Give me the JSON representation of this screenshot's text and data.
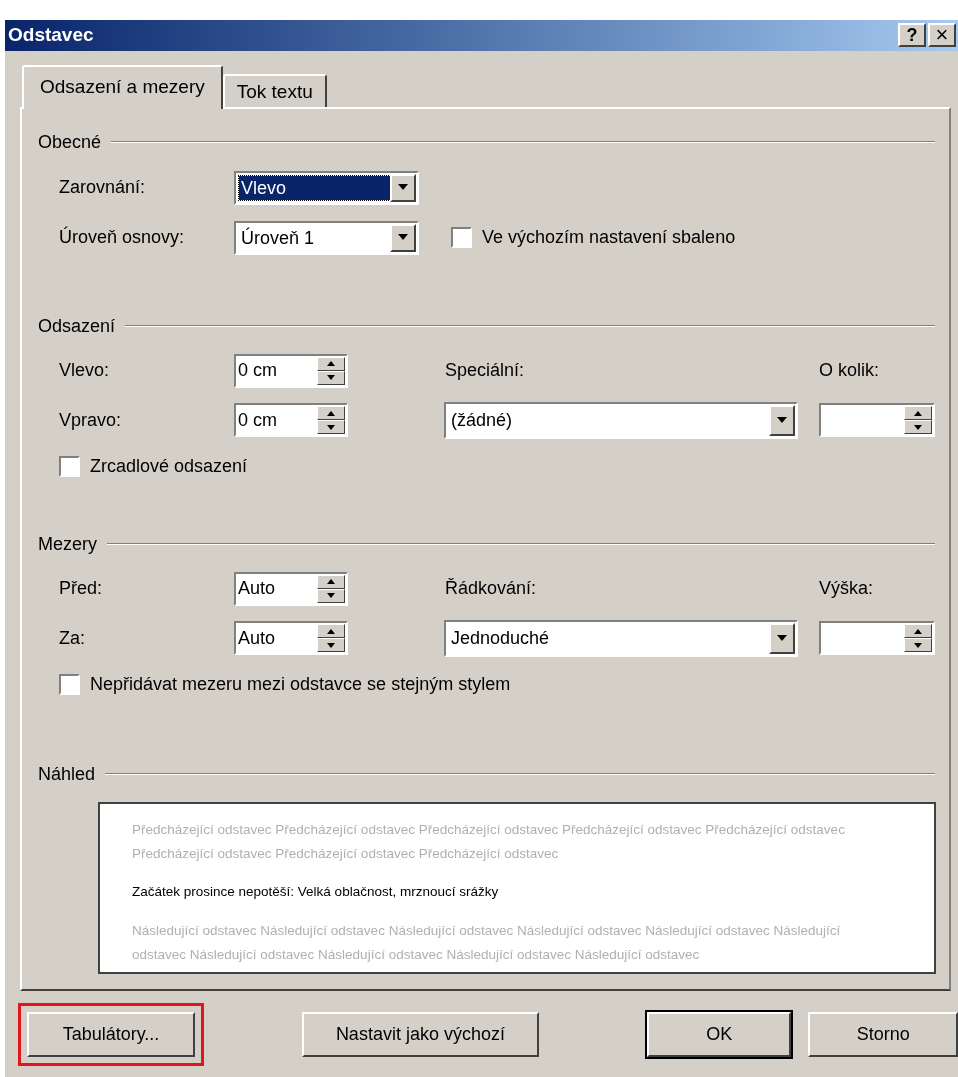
{
  "window": {
    "title": "Odstavec",
    "help": "?",
    "close": "×"
  },
  "tabs": [
    {
      "label": "Odsazení a mezery",
      "selected": true
    },
    {
      "label": "Tok textu",
      "selected": false
    }
  ],
  "general": {
    "heading": "Obecné",
    "alignment": {
      "label": "Zarovnání:",
      "value": "Vlevo",
      "focused": true
    },
    "outline_level": {
      "label": "Úroveň osnovy:",
      "value": "Úroveň 1",
      "focused": false
    },
    "collapsed": {
      "label": "Ve výchozím nastavení sbaleno",
      "checked": false
    }
  },
  "indentation": {
    "heading": "Odsazení",
    "left": {
      "label": "Vlevo:",
      "value": "0 cm"
    },
    "right": {
      "label": "Vpravo:",
      "value": "0 cm"
    },
    "special": {
      "label": "Speciální:",
      "value": "(žádné)"
    },
    "by": {
      "label": "O kolik:"
    },
    "mirror": {
      "label": "Zrcadlové odsazení",
      "checked": false
    }
  },
  "spacing": {
    "heading": "Mezery",
    "before": {
      "label": "Před:",
      "value": "Auto"
    },
    "after": {
      "label": "Za:",
      "value": "Auto"
    },
    "line_spacing": {
      "label": "Řádkování:",
      "value": "Jednoduché"
    },
    "at": {
      "label": "Výška:"
    },
    "no_space": {
      "label": "Nepřidávat mezeru mezi odstavce se stejným stylem",
      "checked": false
    }
  },
  "preview": {
    "heading": "Náhled",
    "previous": "Předcházející odstavec Předcházející odstavec Předcházející odstavec Předcházející odstavec Předcházející odstavec Předcházející odstavec Předcházející odstavec Předcházející odstavec",
    "current": "Začátek prosince nepotěší: Velká oblačnost, mrznoucí srážky",
    "following": "Následující odstavec Následující odstavec Následující odstavec Následující odstavec Následující odstavec Následující odstavec Následující odstavec Následující odstavec Následující odstavec Následující odstavec"
  },
  "buttons": [
    {
      "label": "Tabulátory...",
      "default": false,
      "highlighted": true
    },
    {
      "label": "Nastavit jako výchozí",
      "default": false,
      "highlighted": false
    },
    {
      "label": "OK",
      "default": true,
      "highlighted": false
    },
    {
      "label": "Storno",
      "default": false,
      "highlighted": false
    }
  ]
}
